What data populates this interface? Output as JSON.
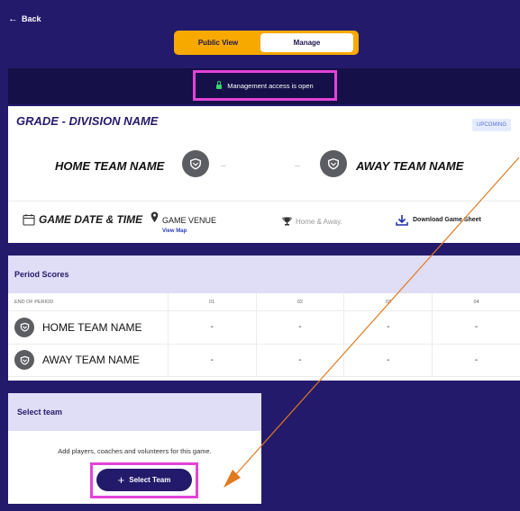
{
  "nav": {
    "back_label": "Back"
  },
  "view_toggle": {
    "public_label": "Public View",
    "manage_label": "Manage"
  },
  "access": {
    "message": "Management access is open"
  },
  "game": {
    "grade_division": "GRADE - DIVISION NAME",
    "status": "UPCOMING",
    "home_team": "HOME TEAM NAME",
    "away_team": "AWAY TEAM NAME",
    "score_placeholder": "–",
    "date_time": "GAME DATE & TIME",
    "venue": "GAME VENUE",
    "view_map": "View Map",
    "home_away": "Home & Away.",
    "download": "Download Game Sheet"
  },
  "periods": {
    "title": "Period Scores",
    "columns": [
      "END OF PERIOD",
      "01",
      "02",
      "03",
      "04"
    ],
    "rows": [
      {
        "team": "HOME TEAM NAME",
        "scores": [
          "-",
          "-",
          "-",
          "-"
        ]
      },
      {
        "team": "AWAY TEAM NAME",
        "scores": [
          "-",
          "-",
          "-",
          "-"
        ]
      }
    ]
  },
  "select_team": {
    "title": "Select team",
    "description": "Add players, coaches and volunteers for this game.",
    "button_label": "Select Team"
  },
  "colors": {
    "background": "#241a6b",
    "accent": "#f7a900",
    "highlight": "#e443d8",
    "annotation_arrow": "#e07a1f"
  }
}
